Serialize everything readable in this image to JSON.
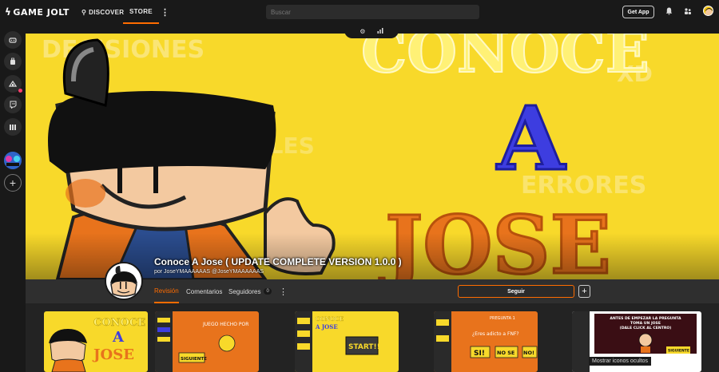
{
  "header": {
    "logo_text": "GAME JOLT",
    "nav_discover": "DISCOVER",
    "nav_store": "STORE",
    "search_placeholder": "Buscar",
    "get_app": "Get App"
  },
  "game": {
    "title": "Conoce A Jose ( UPDATE COMPLETE VERSION 1.0.0 )",
    "author": "por JoseYMAAAAAAS @JoseYMAAAAAAS"
  },
  "banner_art": {
    "word_conoce": "CONOCE",
    "word_a": "A",
    "word_jose": "JOSE",
    "faint_decisiones": "DECISIONES",
    "faint_xd": "XD",
    "faint_errores": "ERRORES",
    "faint_finales": "FINALES"
  },
  "tabs": {
    "revision": "Revisión",
    "comentarios": "Comentarios",
    "seguidores": "Seguidores",
    "seguidores_count": "0"
  },
  "actions": {
    "follow": "Seguir",
    "plus": "+"
  },
  "screenshots": {
    "s1_conoce": "CONOCE",
    "s1_a": "A",
    "s1_jose": "JOSE",
    "s2_juego": "JUEGO HECHO POR",
    "s2_siguiente": "SIGUIENTE",
    "s3_conoce": "CONOCE",
    "s3_a": "A JOSE",
    "s3_start": "START!!",
    "s4_pregunta": "PREGUNTA 1",
    "s4_q": "¿Eres adicto a FNF?",
    "s4_si": "SI!",
    "s4_nose": "NO SE",
    "s4_no": "NO!",
    "s5_line1": "ANTES DE EMPEZAR LA PREGUNTA",
    "s5_line2": "TOMA UN JOSE",
    "s5_line3": "(DALE CLICK AL CENTRO)",
    "s5_siguiente": "SIGUIENTE"
  },
  "hidden_icons_label": "Mostrar iconos ocultos",
  "colors": {
    "accent": "#ff6c00",
    "banner_yellow": "#f8d92a",
    "jose_orange": "#e8731c",
    "a_blue": "#3d3de0"
  }
}
